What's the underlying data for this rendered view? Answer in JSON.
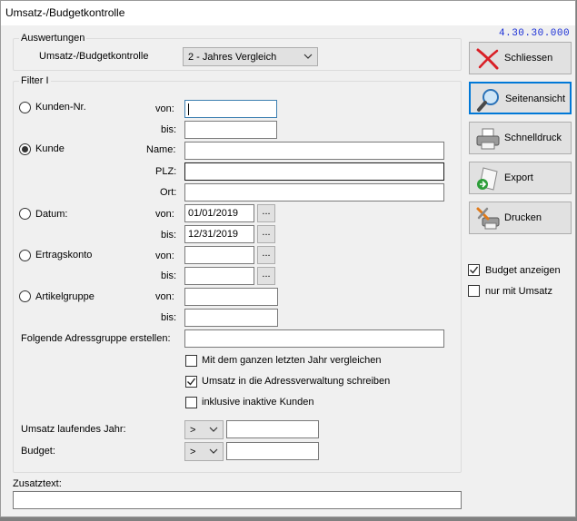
{
  "window": {
    "title": "Umsatz-/Budgetkontrolle",
    "version": "4.30.30.000"
  },
  "auswertungen": {
    "legend": "Auswertungen",
    "label": "Umsatz-/Budgetkontrolle",
    "selected": "2 - Jahres Vergleich"
  },
  "filter": {
    "legend": "Filter I",
    "kunden_nr": {
      "radio_label": "Kunden-Nr.",
      "von_label": "von:",
      "bis_label": "bis:",
      "von_value": "",
      "bis_value": ""
    },
    "kunde": {
      "radio_label": "Kunde",
      "name_label": "Name:",
      "plz_label": "PLZ:",
      "ort_label": "Ort:",
      "name_value": "",
      "plz_value": "",
      "ort_value": ""
    },
    "datum": {
      "radio_label": "Datum:",
      "von_label": "von:",
      "bis_label": "bis:",
      "von_value": "01/01/2019",
      "bis_value": "12/31/2019"
    },
    "ertragskonto": {
      "radio_label": "Ertragskonto",
      "von_label": "von:",
      "bis_label": "bis:",
      "von_value": "",
      "bis_value": ""
    },
    "artikelgruppe": {
      "radio_label": "Artikelgruppe",
      "von_label": "von:",
      "bis_label": "bis:",
      "von_value": "",
      "bis_value": ""
    },
    "browse_label": "...",
    "adressgruppe_label": "Folgende Adressgruppe erstellen:",
    "adressgruppe_value": "",
    "opt_vergleich": "Mit dem ganzen letzten Jahr vergleichen",
    "opt_schreiben": "Umsatz in die Adressverwaltung schreiben",
    "opt_inaktive": "inklusive inaktive Kunden",
    "umsatz_label": "Umsatz laufendes Jahr:",
    "umsatz_op": ">",
    "umsatz_value": "",
    "budget_label": "Budget:",
    "budget_op": ">",
    "budget_value": ""
  },
  "zusatztext": {
    "label": "Zusatztext:",
    "value": ""
  },
  "buttons": {
    "schliessen": "Schliessen",
    "seitenansicht": "Seitenansicht",
    "schnelldruck": "Schnelldruck",
    "export": "Export",
    "drucken": "Drucken"
  },
  "side_options": {
    "budget_anzeigen": "Budget anzeigen",
    "nur_mit_umsatz": "nur mit Umsatz"
  },
  "colors": {
    "version_text": "#1a2fd6",
    "focus_border": "#0078d7",
    "window_bg": "#f0f0f0"
  }
}
